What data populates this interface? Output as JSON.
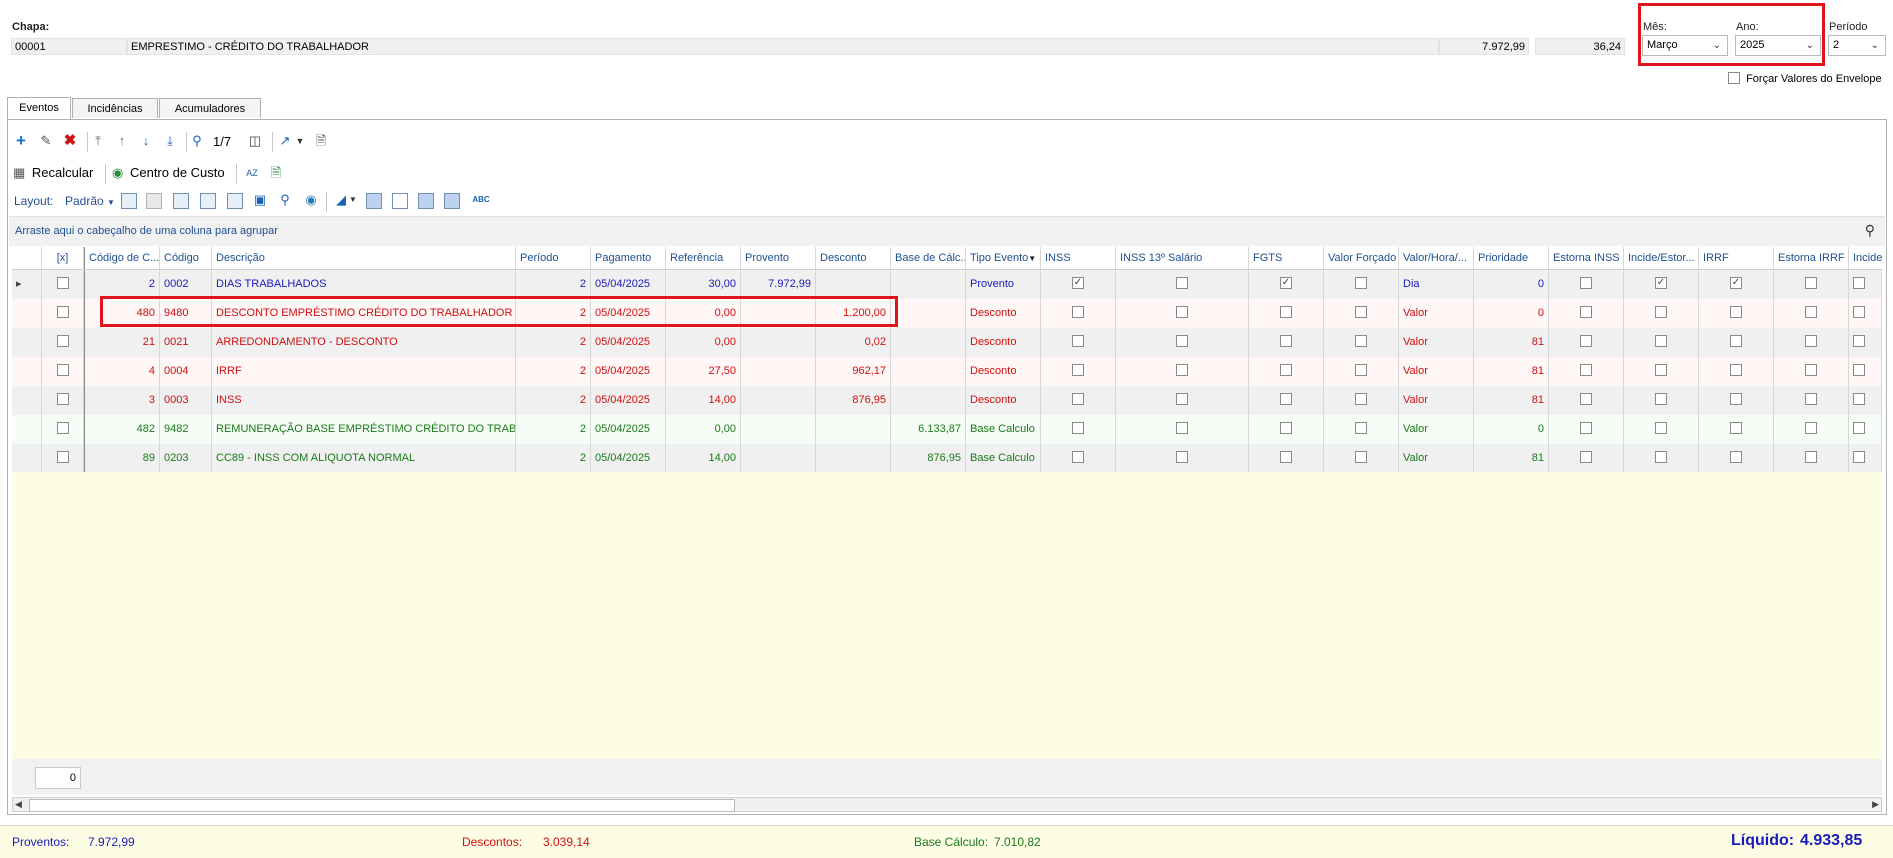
{
  "header": {
    "chapa_label": "Chapa:",
    "chapa_code": "00001",
    "chapa_desc": "EMPRESTIMO - CRÉDITO DO TRABALHADOR",
    "value_a": "7.972,99",
    "value_b": "36,24",
    "mes_label": "Mês:",
    "mes_value": "Março",
    "ano_label": "Ano:",
    "ano_value": "2025",
    "periodo_label": "Período",
    "periodo_value": "2",
    "forcar_label": "Forçar Valores do Envelope"
  },
  "tabs": [
    "Eventos",
    "Incidências",
    "Acumuladores"
  ],
  "toolbar": {
    "page_counter": "1/7",
    "recalcular_label": "Recalcular",
    "centro_label": "Centro de Custo",
    "layout_label": "Layout:",
    "padrao_label": "Padrão"
  },
  "grid": {
    "group_hint": "Arraste aqui o cabeçalho de uma coluna para agrupar",
    "headers": [
      "[x]",
      "Código de C...",
      "Código",
      "Descrição",
      "Período",
      "Pagamento",
      "Referência",
      "Provento",
      "Desconto",
      "Base de Cálc...",
      "Tipo Evento",
      "INSS",
      "INSS 13º Salário",
      "FGTS",
      "Valor Forçado",
      "Valor/Hora/...",
      "Prioridade",
      "Estorna INSS",
      "Incide/Estor...",
      "IRRF",
      "Estorna IRRF",
      "Incide/"
    ],
    "rows": [
      {
        "cc": "2",
        "codigo": "0002",
        "descricao": "DIAS TRABALHADOS",
        "periodo": "2",
        "pagamento": "05/04/2025",
        "referencia": "30,00",
        "provento": "7.972,99",
        "desconto": "",
        "base": "",
        "tipo": "Provento",
        "vhd": "Dia",
        "prioridade": "0",
        "color": "#1a1ab8",
        "checks": {
          "inss": true,
          "fgts": true,
          "incide": true,
          "irrf": true
        }
      },
      {
        "cc": "480",
        "codigo": "9480",
        "descricao": "DESCONTO EMPRÉSTIMO CRÉDITO DO TRABALHADOR",
        "periodo": "2",
        "pagamento": "05/04/2025",
        "referencia": "0,00",
        "provento": "",
        "desconto": "1.200,00",
        "base": "",
        "tipo": "Desconto",
        "vhd": "Valor",
        "prioridade": "0",
        "color": "#d01010",
        "checks": {}
      },
      {
        "cc": "21",
        "codigo": "0021",
        "descricao": "ARREDONDAMENTO - DESCONTO",
        "periodo": "2",
        "pagamento": "05/04/2025",
        "referencia": "0,00",
        "provento": "",
        "desconto": "0,02",
        "base": "",
        "tipo": "Desconto",
        "vhd": "Valor",
        "prioridade": "81",
        "color": "#d01010",
        "checks": {}
      },
      {
        "cc": "4",
        "codigo": "0004",
        "descricao": "IRRF",
        "periodo": "2",
        "pagamento": "05/04/2025",
        "referencia": "27,50",
        "provento": "",
        "desconto": "962,17",
        "base": "",
        "tipo": "Desconto",
        "vhd": "Valor",
        "prioridade": "81",
        "color": "#d01010",
        "checks": {}
      },
      {
        "cc": "3",
        "codigo": "0003",
        "descricao": "INSS",
        "periodo": "2",
        "pagamento": "05/04/2025",
        "referencia": "14,00",
        "provento": "",
        "desconto": "876,95",
        "base": "",
        "tipo": "Desconto",
        "vhd": "Valor",
        "prioridade": "81",
        "color": "#d01010",
        "checks": {}
      },
      {
        "cc": "482",
        "codigo": "9482",
        "descricao": "REMUNERAÇÃO BASE EMPRÉSTIMO CRÉDITO DO TRABAL...",
        "periodo": "2",
        "pagamento": "05/04/2025",
        "referencia": "0,00",
        "provento": "",
        "desconto": "",
        "base": "6.133,87",
        "tipo": "Base Calculo",
        "vhd": "Valor",
        "prioridade": "0",
        "color": "#1a7a1a",
        "checks": {}
      },
      {
        "cc": "89",
        "codigo": "0203",
        "descricao": "CC89 - INSS COM ALIQUOTA NORMAL",
        "periodo": "2",
        "pagamento": "05/04/2025",
        "referencia": "14,00",
        "provento": "",
        "desconto": "",
        "base": "876,95",
        "tipo": "Base Calculo",
        "vhd": "Valor",
        "prioridade": "81",
        "color": "#1a7a1a",
        "checks": {}
      }
    ],
    "count_value": "0"
  },
  "footer": {
    "proventos_label": "Proventos:",
    "proventos_value": "7.972,99",
    "descontos_label": "Descontos:",
    "descontos_value": "3.039,14",
    "base_label": "Base Cálculo:",
    "base_value": "7.010,82",
    "liquido_label": "Líquido:",
    "liquido_value": "4.933,85"
  },
  "colors": {
    "provento": "#1a1ab8",
    "desconto": "#d01010",
    "base": "#1a7a1a",
    "highlight": "#e0141c"
  }
}
